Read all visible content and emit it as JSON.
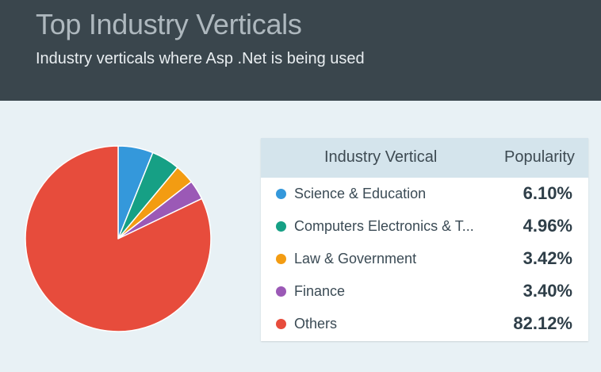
{
  "header": {
    "title": "Top Industry Verticals",
    "subtitle": "Industry verticals where Asp .Net is being used"
  },
  "table": {
    "col_vertical": "Industry Vertical",
    "col_popularity": "Popularity",
    "rows": [
      {
        "label": "Science & Education",
        "value": "6.10%",
        "color": "#3498db"
      },
      {
        "label": "Computers Electronics & T...",
        "value": "4.96%",
        "color": "#16a085"
      },
      {
        "label": "Law & Government",
        "value": "3.42%",
        "color": "#f39c12"
      },
      {
        "label": "Finance",
        "value": "3.40%",
        "color": "#9b59b6"
      },
      {
        "label": "Others",
        "value": "82.12%",
        "color": "#e74c3c"
      }
    ]
  },
  "chart_data": {
    "type": "pie",
    "categories": [
      "Science & Education",
      "Computers Electronics & T...",
      "Law & Government",
      "Finance",
      "Others"
    ],
    "values": [
      6.1,
      4.96,
      3.42,
      3.4,
      82.12
    ],
    "colors": [
      "#3498db",
      "#16a085",
      "#f39c12",
      "#9b59b6",
      "#e74c3c"
    ],
    "start_angle": "12 o'clock, clockwise",
    "slice_border": "#ffffff"
  }
}
